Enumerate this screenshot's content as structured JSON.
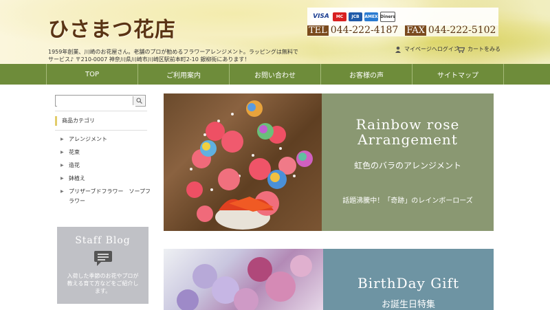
{
  "header": {
    "logo": "ひさまつ花店",
    "tagline": "1959年創業、川崎のお花屋さん。老舗のプロが勧めるフラワーアレンジメント。ラッピングは無料でサービス♪ 〒210-0007 神奈川県川崎市川崎区駅前本町2-10 銀柳街にあります！",
    "cards": [
      "VISA",
      "MC",
      "JCB",
      "AMEX",
      "Diners"
    ],
    "tel_label": "TEL",
    "tel": "044-222-4187",
    "fax_label": "FAX",
    "fax": "044-222-5102",
    "mypage": "マイページへログイン",
    "cart": "カートをみる"
  },
  "nav": [
    "TOP",
    "ご利用案内",
    "お問い合わせ",
    "お客様の声",
    "サイトマップ"
  ],
  "sidebar": {
    "search_placeholder": "",
    "category_title": "商品カテゴリ",
    "categories": [
      "アレンジメント",
      "花束",
      "造花",
      "鉢植え",
      "プリザーブドフラワー　ソープフラワー"
    ],
    "blog_title": "Staff Blog",
    "blog_text": "入荷した季節のお花やプロが教える育て方などをご紹介します。"
  },
  "banners": {
    "b1_title": "Rainbow rose Arrangement",
    "b1_sub": "虹色のバラのアレンジメント",
    "b1_caption": "話題沸騰中！「奇跡」のレインボーローズ",
    "b2_title": "BirthDay Gift",
    "b2_sub": "お誕生日特集"
  },
  "colors": {
    "nav": "#6e8c3a",
    "banner1": "#8a9872",
    "banner2": "#6e94a3",
    "logo": "#5a3414"
  }
}
